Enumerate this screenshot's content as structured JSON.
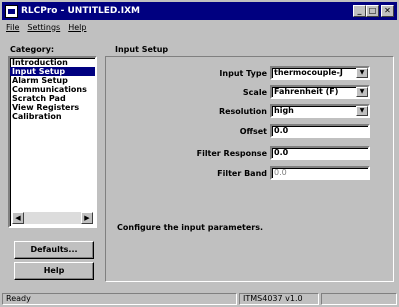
{
  "window": {
    "title": "RLCPro - UNTITLED.IXM",
    "min": "_",
    "max": "□",
    "close": "✕"
  },
  "menu": [
    "File",
    "Settings",
    "Help"
  ],
  "category": {
    "label": "Category:",
    "items": [
      "Introduction",
      "Input Setup",
      "Alarm Setup",
      "Communications",
      "Scratch Pad",
      "View Registers",
      "Calibration"
    ],
    "selected": 1,
    "scroll_left": "◀",
    "scroll_right": "▶"
  },
  "buttons": {
    "defaults": "Defaults...",
    "help": "Help"
  },
  "panel": {
    "title": "Input Setup",
    "fields": {
      "input_type": {
        "label": "Input Type",
        "value": "thermocouple-J",
        "arrow": "▼"
      },
      "scale": {
        "label": "Scale",
        "value": "Fahrenheit (F)",
        "arrow": "▼"
      },
      "resolution": {
        "label": "Resolution",
        "value": "high",
        "arrow": "▼"
      },
      "offset": {
        "label": "Offset",
        "value": "0.0"
      },
      "filter_response": {
        "label": "Filter Response",
        "value": "0.0"
      },
      "filter_band": {
        "label": "Filter Band",
        "value": "0.0"
      }
    },
    "description": "Configure the input parameters."
  },
  "status": {
    "left": "Ready",
    "middle": "ITMS4037 v1.0",
    "right": ""
  }
}
